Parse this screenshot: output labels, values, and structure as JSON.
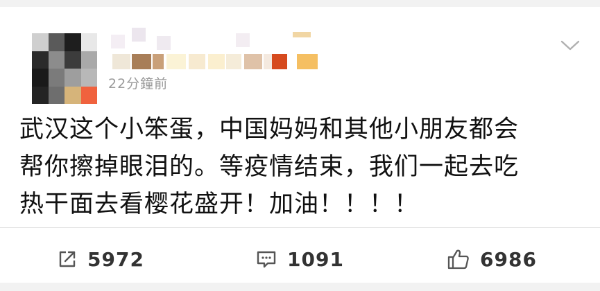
{
  "post": {
    "timestamp": "22分鐘前",
    "text_lines": [
      "武汉这个小笨蛋，中国妈妈和其他小朋友都会",
      "帮你擦掉眼泪的。等疫情结束，我们一起去吃",
      "热干面去看樱花盛开！加油！！！！"
    ]
  },
  "actions": {
    "repost_count": "5972",
    "comment_count": "1091",
    "like_count": "6986"
  },
  "icons": {
    "repost": "share-icon",
    "comment": "comment-icon",
    "like": "thumbs-up-icon",
    "menu": "chevron-down-icon"
  },
  "colors": {
    "background": "#f2f2f2",
    "card": "#ffffff",
    "text": "#111111",
    "muted": "#9a9a9a",
    "icon": "#555555"
  }
}
